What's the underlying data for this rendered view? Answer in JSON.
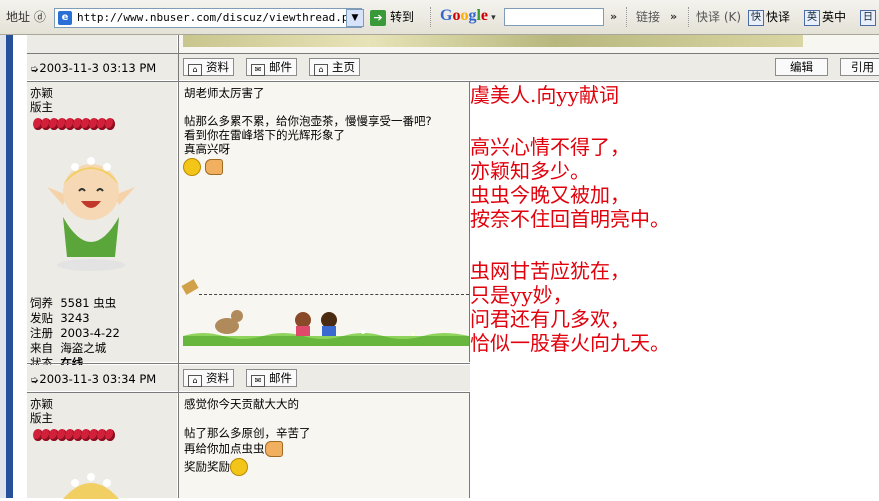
{
  "toolbar": {
    "address_label": "地址 ⓓ",
    "url": "http://www.nbuser.com/discuz/viewthread.php?t",
    "go_label": "转到",
    "google_letters": [
      "G",
      "o",
      "o",
      "g",
      "l",
      "e"
    ],
    "google_search_value": "",
    "links_label": "链接",
    "kuaiyi_label": "快译 (K)",
    "kuaiyi_button": "快译",
    "yingzhong_button": "英中",
    "last_button": "日"
  },
  "posts": [
    {
      "time": "2003-11-3 03:13 PM",
      "buttons": [
        "资料",
        "邮件",
        "主页"
      ],
      "right_buttons": [
        "编辑",
        "引用"
      ],
      "author": "亦颖",
      "role": "版主",
      "stats": [
        {
          "label": "饲养",
          "value": "5581 虫虫"
        },
        {
          "label": "发贴",
          "value": "3243"
        },
        {
          "label": "注册",
          "value": "2003-4-22"
        },
        {
          "label": "来自",
          "value": "海盗之城"
        },
        {
          "label": "状态",
          "value": "在线"
        }
      ],
      "lines": [
        "胡老师太厉害了",
        "",
        "帖那么多累不累，给你泡壶茶，慢慢享受一番吧?",
        "看到你在雷峰塔下的光辉形象了",
        "真高兴呀"
      ]
    },
    {
      "time": "2003-11-3 03:34 PM",
      "buttons": [
        "资料",
        "邮件"
      ],
      "author": "亦颖",
      "role": "版主",
      "lines": [
        "感觉你今天贡献大大的",
        "",
        "帖了那么多原创，辛苦了",
        "再给你加点虫虫",
        "奖励奖励"
      ]
    }
  ],
  "poem": [
    "虞美人.向yy献词",
    "",
    "",
    "高兴心情不得了，",
    "亦颖知多少。",
    "虫虫今晚又被加，",
    "按奈不住回首明亮中。",
    "",
    "",
    "虫网甘苦应犹在，",
    "只是yy妙，",
    "问君还有几多欢，",
    "恰似一股春火向九天。"
  ],
  "colors": {
    "poem_red": "#e1000b",
    "row_header": "#ecebe6",
    "left_strip": "#26509a"
  }
}
